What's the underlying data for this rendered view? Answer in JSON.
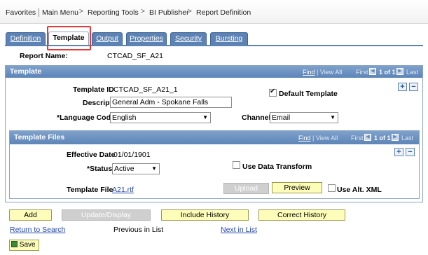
{
  "breadcrumb": {
    "items": [
      "Favorites",
      "Main Menu",
      "Reporting Tools",
      "BI Publisher",
      "Report Definition"
    ]
  },
  "tabs": [
    {
      "label": "Definition",
      "active": false
    },
    {
      "label": "Template",
      "active": true
    },
    {
      "label": "Output",
      "active": false
    },
    {
      "label": "Properties",
      "active": false
    },
    {
      "label": "Security",
      "active": false
    },
    {
      "label": "Bursting",
      "active": false
    }
  ],
  "report": {
    "name_label": "Report Name:",
    "name_value": "CTCAD_SF_A21"
  },
  "template_section": {
    "title": "Template",
    "nav": {
      "find": "Find",
      "view_all": "View All",
      "first": "First",
      "count": "1 of 1",
      "last": "Last"
    },
    "template_id_label": "Template ID",
    "template_id_value": "CTCAD_SF_A21_1",
    "default_template_label": "Default Template",
    "default_template_checked": true,
    "description_label": "Description",
    "description_value": "General Adm - Spokane Falls",
    "language_label": "*Language Code",
    "language_value": "English",
    "channel_label": "Channel",
    "channel_value": "Email",
    "add_symbol": "+",
    "remove_symbol": "−"
  },
  "files_section": {
    "title": "Template Files",
    "nav": {
      "find": "Find",
      "view_all": "View All",
      "first": "First",
      "count": "1 of 1",
      "last": "Last"
    },
    "effective_date_label": "Effective Date",
    "effective_date_value": "01/01/1901",
    "status_label": "*Status",
    "status_value": "Active",
    "use_data_transform_label": "Use Data Transform",
    "template_file_label": "Template File",
    "template_file_value": "A21.rtf",
    "upload_label": "Upload",
    "preview_label": "Preview",
    "use_alt_xml_label": "Use Alt. XML",
    "add_symbol": "+",
    "remove_symbol": "−"
  },
  "actions": {
    "add": "Add",
    "update_display": "Update/Display",
    "include_history": "Include History",
    "correct_history": "Correct History",
    "return_to_search": "Return to Search",
    "previous_in_list": "Previous in List",
    "next_in_list": "Next in List",
    "save": "Save"
  },
  "colors": {
    "header_blue": "#5d85b8",
    "button_yellow": "#fdfdb9",
    "highlight_red": "#e03a3a"
  }
}
